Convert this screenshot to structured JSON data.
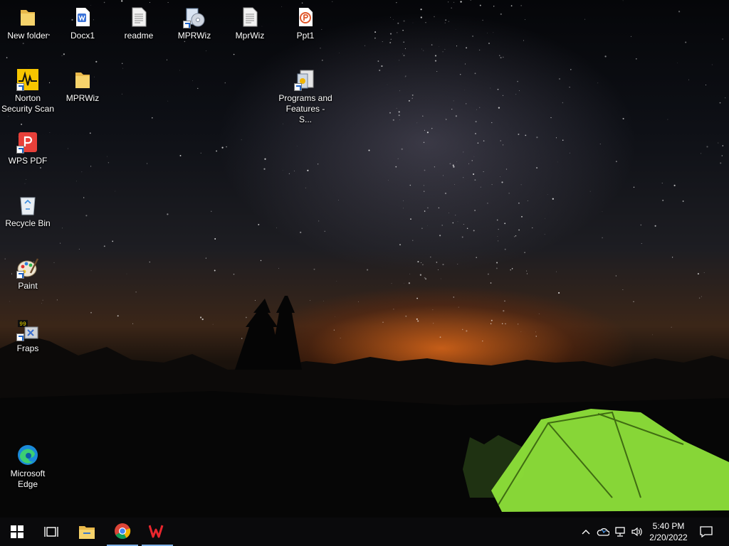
{
  "desktop": {
    "icons": [
      {
        "id": "new-folder",
        "label": "New folder"
      },
      {
        "id": "docx1",
        "label": "Docx1"
      },
      {
        "id": "readme",
        "label": "readme"
      },
      {
        "id": "mprwiz-setup",
        "label": "MPRWiz"
      },
      {
        "id": "mprwiz-file",
        "label": "MprWiz"
      },
      {
        "id": "ppt1",
        "label": "Ppt1"
      },
      {
        "id": "norton",
        "label": "Norton Security Scan"
      },
      {
        "id": "mprwiz-folder",
        "label": "MPRWiz"
      },
      {
        "id": "programs-features",
        "label": "Programs and Features - S..."
      },
      {
        "id": "wps-pdf",
        "label": "WPS PDF"
      },
      {
        "id": "recycle-bin",
        "label": "Recycle Bin"
      },
      {
        "id": "paint",
        "label": "Paint"
      },
      {
        "id": "fraps",
        "label": "Fraps"
      },
      {
        "id": "edge",
        "label": "Microsoft Edge"
      }
    ]
  },
  "taskbar": {
    "pinned": [
      "Start",
      "Task View",
      "File Explorer",
      "Google Chrome",
      "WPS Office"
    ],
    "tray": {
      "icons": [
        "chevron-up-icon",
        "onedrive-icon",
        "network-icon",
        "volume-icon"
      ],
      "time": "5:40 PM",
      "date": "2/20/2022",
      "notification_icon": "action-center-icon"
    }
  },
  "colors": {
    "taskbar": "#0a0a0c",
    "tent": "#8ee23a",
    "glow": "#e0691a",
    "active_indicator": "#7fb2e8"
  }
}
